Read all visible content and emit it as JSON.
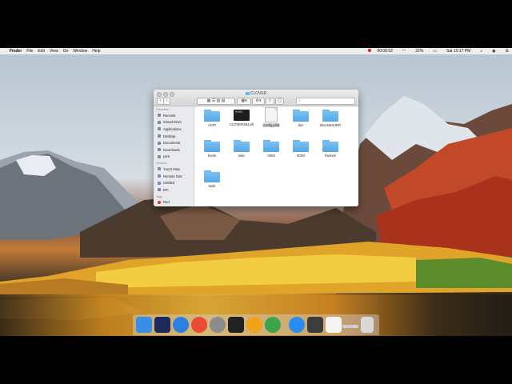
{
  "menubar": {
    "apple": "",
    "app": "Finder",
    "items": [
      "File",
      "Edit",
      "View",
      "Go",
      "Window",
      "Help"
    ],
    "recording": "00:00:52",
    "battery": "22%",
    "clock": "Sat 10:17 PM"
  },
  "window": {
    "title": "CLOVER",
    "sidebar": {
      "favorites_header": "Favorites",
      "favorites": [
        "Recents",
        "iCloud Drive",
        "Applications",
        "Desktop",
        "Documents",
        "Downloads",
        "york"
      ],
      "devices_header": "Devices",
      "devices": [
        "Yury's iMac",
        "Remote Disc",
        "Untitled",
        "EFI"
      ],
      "tags_header": "Tags",
      "tags": [
        "Red"
      ]
    },
    "items": [
      {
        "name": "ACPI",
        "kind": "folder"
      },
      {
        "name": "CLOVERX64.efi",
        "kind": "executable"
      },
      {
        "name": "config.plist",
        "kind": "document",
        "selected": true
      },
      {
        "name": "doc",
        "kind": "folder"
      },
      {
        "name": "drivers64UEFI",
        "kind": "folder"
      },
      {
        "name": "kexts",
        "kind": "folder"
      },
      {
        "name": "misc",
        "kind": "folder"
      },
      {
        "name": "OEM",
        "kind": "folder"
      },
      {
        "name": "ROM",
        "kind": "folder"
      },
      {
        "name": "themes",
        "kind": "folder"
      },
      {
        "name": "tools",
        "kind": "folder"
      }
    ],
    "term_text": "exec"
  },
  "dock": {
    "apps": [
      "finder",
      "photoshop",
      "safari",
      "chrome",
      "system-preferences",
      "terminal",
      "google-drive",
      "maps",
      "app-store",
      "installer",
      "notes",
      "downloads",
      "trash"
    ],
    "colors": [
      "#3b8ee5",
      "#1b2a5a",
      "#2f7fe0",
      "#e94b35",
      "#8c8c8c",
      "#222222",
      "#f0a21a",
      "#3aa54a",
      "#2b8cf0",
      "#3c3c3c",
      "#f4f4f4",
      "#cfcfcf",
      "#d9d9d9"
    ]
  }
}
